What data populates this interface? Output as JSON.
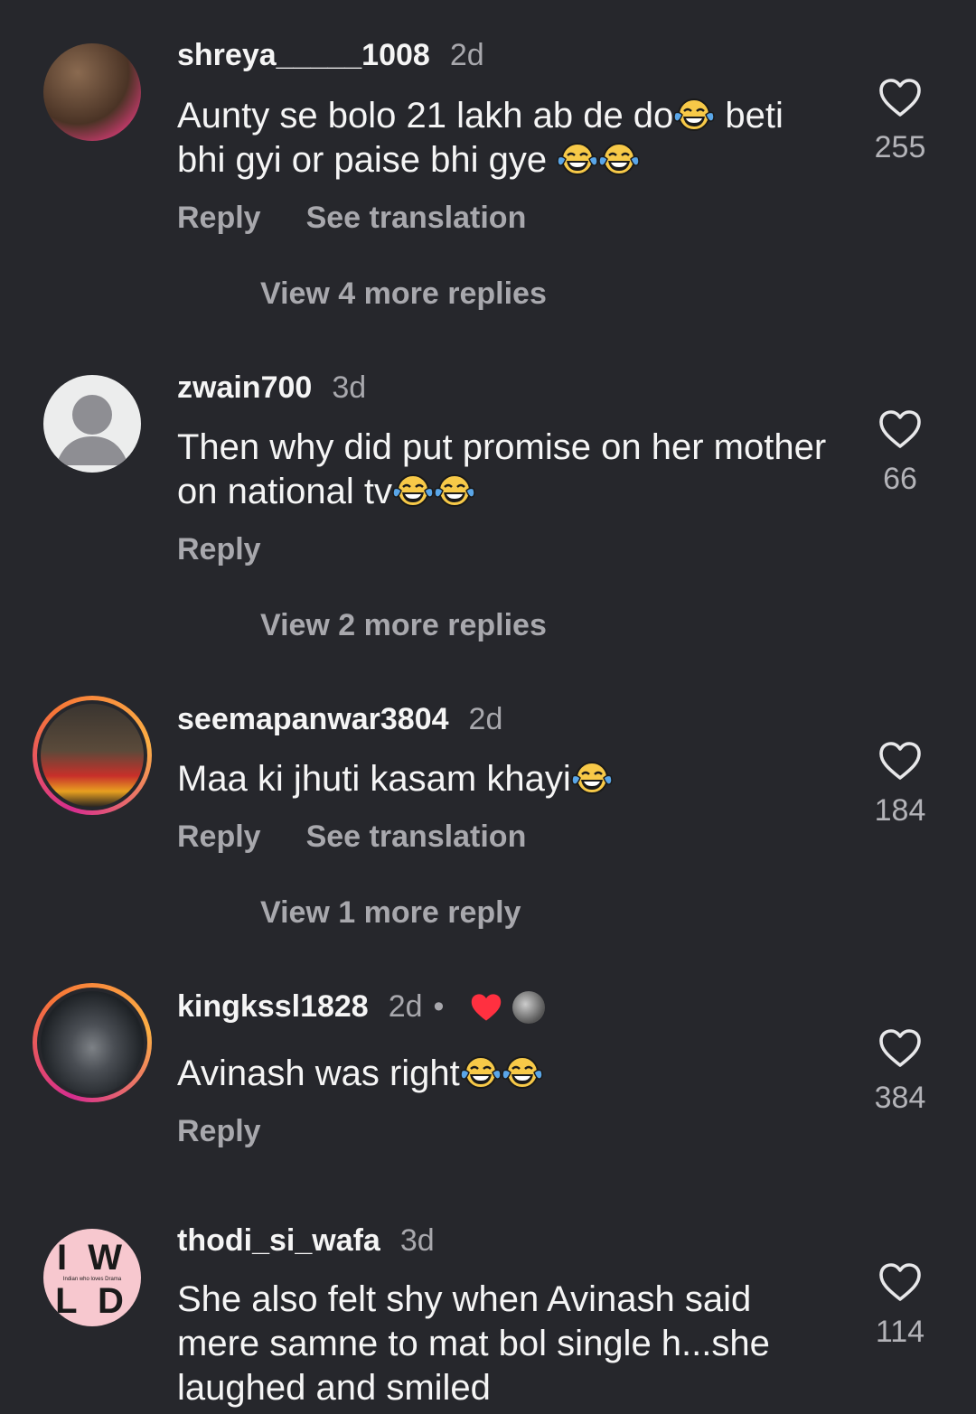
{
  "comments": [
    {
      "username": "shreya_____1008",
      "time": "2d",
      "text_parts": [
        "Aunty se bolo 21 lakh ab de do",
        " beti bhi gyi or paise bhi gye "
      ],
      "likes": "255",
      "reply": "Reply",
      "translate": "See translation",
      "more_replies": "View 4 more replies"
    },
    {
      "username": "zwain700",
      "time": "3d",
      "text_parts": [
        "Then why did put promise on her mother on national tv"
      ],
      "likes": "66",
      "reply": "Reply",
      "more_replies": "View 2 more replies"
    },
    {
      "username": "seemapanwar3804",
      "time": "2d",
      "text_parts": [
        "Maa ki jhuti kasam khayi"
      ],
      "likes": "184",
      "reply": "Reply",
      "translate": "See translation",
      "more_replies": "View 1 more reply"
    },
    {
      "username": "kingkssl1828",
      "time": "2d",
      "separator": "•",
      "text_parts": [
        "Avinash was right"
      ],
      "likes": "384",
      "reply": "Reply"
    },
    {
      "username": "thodi_si_wafa",
      "time": "3d",
      "text_parts": [
        "She also felt shy when Avinash said mere samne to mat bol single h...she laughed and smiled"
      ],
      "likes": "114"
    }
  ],
  "avatar5_logo": {
    "line1": "I W",
    "line2": "L D",
    "tagline": "Indian who loves Drama"
  },
  "icons": {
    "like": "heart-outline-icon",
    "emoji": "face-with-tears-of-joy-icon",
    "creator_like": "red-heart-icon"
  },
  "colors": {
    "background": "#26272c",
    "secondary_text": "#a8a8ad",
    "heart_red": "#ff3040"
  }
}
